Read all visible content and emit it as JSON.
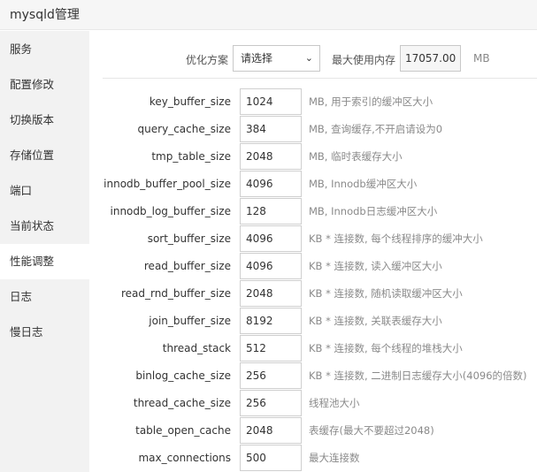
{
  "window": {
    "title": "mysqld管理"
  },
  "sidebar": {
    "items": [
      {
        "label": "服务"
      },
      {
        "label": "配置修改"
      },
      {
        "label": "切换版本"
      },
      {
        "label": "存储位置"
      },
      {
        "label": "端口"
      },
      {
        "label": "当前状态"
      },
      {
        "label": "性能调整",
        "active": true
      },
      {
        "label": "日志"
      },
      {
        "label": "慢日志"
      }
    ]
  },
  "optimize": {
    "plan_label": "优化方案",
    "plan_selected": "请选择",
    "max_mem_label": "最大使用内存",
    "max_mem_value": "17057.00",
    "max_mem_unit": "MB"
  },
  "params": [
    {
      "name": "key_buffer_size",
      "value": "1024",
      "note": "MB, 用于索引的缓冲区大小"
    },
    {
      "name": "query_cache_size",
      "value": "384",
      "note": "MB, 查询缓存,不开启请设为0"
    },
    {
      "name": "tmp_table_size",
      "value": "2048",
      "note": "MB, 临时表缓存大小"
    },
    {
      "name": "innodb_buffer_pool_size",
      "value": "4096",
      "note": "MB, Innodb缓冲区大小"
    },
    {
      "name": "innodb_log_buffer_size",
      "value": "128",
      "note": "MB, Innodb日志缓冲区大小"
    },
    {
      "name": "sort_buffer_size",
      "value": "4096",
      "note": "KB * 连接数, 每个线程排序的缓冲大小"
    },
    {
      "name": "read_buffer_size",
      "value": "4096",
      "note": "KB * 连接数, 读入缓冲区大小"
    },
    {
      "name": "read_rnd_buffer_size",
      "value": "2048",
      "note": "KB * 连接数, 随机读取缓冲区大小"
    },
    {
      "name": "join_buffer_size",
      "value": "8192",
      "note": "KB * 连接数, 关联表缓存大小"
    },
    {
      "name": "thread_stack",
      "value": "512",
      "note": "KB * 连接数, 每个线程的堆栈大小"
    },
    {
      "name": "binlog_cache_size",
      "value": "256",
      "note": "KB * 连接数, 二进制日志缓存大小(4096的倍数)"
    },
    {
      "name": "thread_cache_size",
      "value": "256",
      "note": "线程池大小"
    },
    {
      "name": "table_open_cache",
      "value": "2048",
      "note": "表缓存(最大不要超过2048)"
    },
    {
      "name": "max_connections",
      "value": "500",
      "note": "最大连接数"
    }
  ]
}
